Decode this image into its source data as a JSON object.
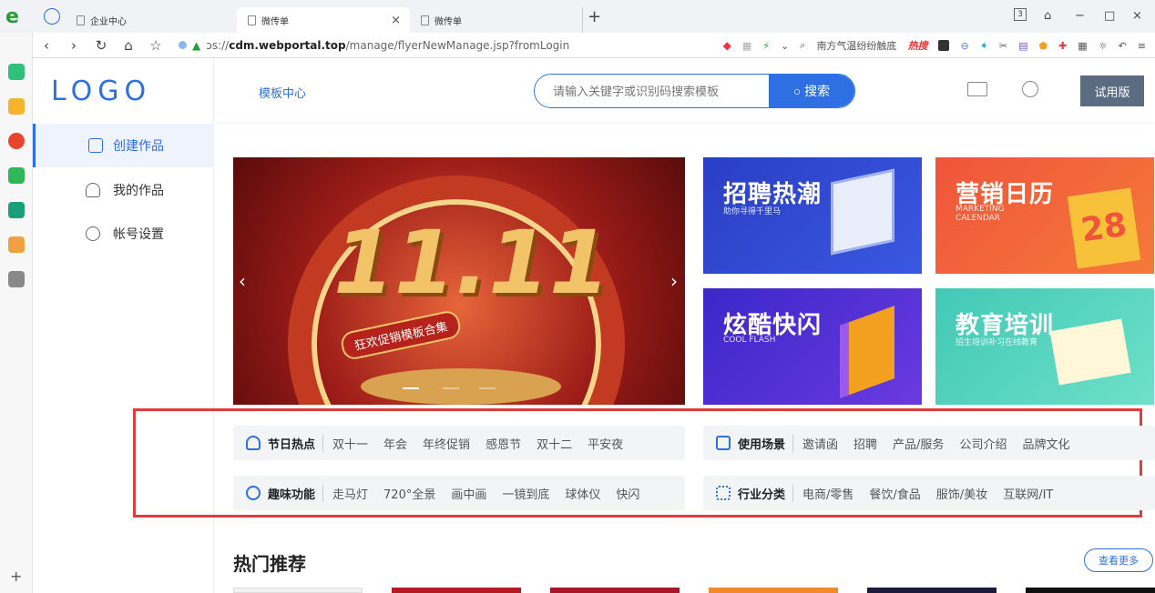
{
  "browser": {
    "tabs": [
      {
        "label": "企业中心"
      },
      {
        "label": "微传单"
      },
      {
        "label": "微传单"
      }
    ],
    "url": {
      "host_prefix": "ɔs://",
      "host": "cdm.webportal.top",
      "path": "/manage/flyerNewManage.jsp?fromLogin"
    },
    "search_hint": "南方气温纷纷触底",
    "hot_label": "热搜",
    "tab_count": "3"
  },
  "app": {
    "logo": "LOGO",
    "nav_link": "模板中心",
    "search": {
      "placeholder": "请输入关键字或识别码搜索模板",
      "button": "搜索"
    },
    "trial_button": "试用版",
    "menu": [
      {
        "label": "创建作品",
        "icon": "create-icon"
      },
      {
        "label": "我的作品",
        "icon": "user-icon"
      },
      {
        "label": "帐号设置",
        "icon": "settings-icon"
      }
    ],
    "banners": [
      {
        "title": "招聘热潮",
        "subtitle": "助你寻得千里马",
        "color": "#2a3ec4"
      },
      {
        "title": "营销日历",
        "subtitle": "MARKETING CALENDAR",
        "color": "#f0543a"
      },
      {
        "title": "炫酷快闪",
        "subtitle": "COOL FLASH",
        "color": "#5a2fd6"
      },
      {
        "title": "教育培训",
        "subtitle": "招生培训补习在线教育",
        "color": "#41c9b6"
      }
    ],
    "hero": {
      "caption": "狂欢促销模板合集",
      "number": "11.11"
    },
    "tag_groups": [
      {
        "category": "节日热点",
        "tags": [
          "双十一",
          "年会",
          "年终促销",
          "感恩节",
          "双十二",
          "平安夜"
        ]
      },
      {
        "category": "使用场景",
        "tags": [
          "邀请函",
          "招聘",
          "产品/服务",
          "公司介绍",
          "品牌文化"
        ]
      },
      {
        "category": "趣味功能",
        "tags": [
          "走马灯",
          "720°全景",
          "画中画",
          "一镜到底",
          "球体仪",
          "快闪"
        ]
      },
      {
        "category": "行业分类",
        "tags": [
          "电商/零售",
          "餐饮/食品",
          "服饰/美妆",
          "互联网/IT"
        ]
      }
    ],
    "section_title": "热门推荐",
    "more_button": "查看更多"
  }
}
